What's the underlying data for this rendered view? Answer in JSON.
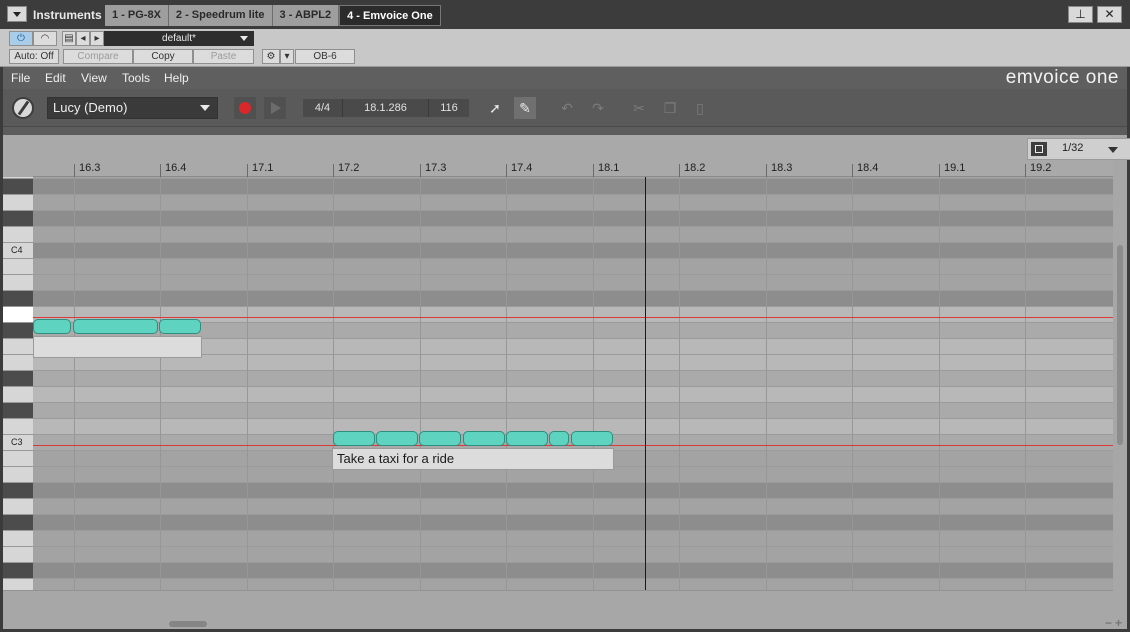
{
  "host": {
    "title": "Instruments",
    "tabs": [
      "1 - PG-8X",
      "2 - Speedrum lite",
      "3 - ABPL2",
      "4 - Emvoice One"
    ],
    "active_tab": 3,
    "pin_glyph": "⊥",
    "close_glyph": "✕"
  },
  "plugin_header": {
    "auto_label": "Auto: Off",
    "compare_label": "Compare",
    "copy_label": "Copy",
    "paste_label": "Paste",
    "preset_name": "default*",
    "device_name": "OB-6"
  },
  "menu": {
    "items": [
      "File",
      "Edit",
      "View",
      "Tools",
      "Help"
    ],
    "brand": "emvoice one"
  },
  "toolbar": {
    "voice": "Lucy (Demo)",
    "time_signature": "4/4",
    "position": "18.1.286",
    "tempo": "116",
    "icons": {
      "select": "arrow-icon",
      "draw": "pencil-icon",
      "undo": "undo-icon",
      "redo": "redo-icon",
      "cut": "scissors-icon",
      "copy": "copy-icon",
      "paste": "clipboard-icon"
    }
  },
  "ruler": {
    "bars": [
      "16.3",
      "16.4",
      "17.1",
      "17.2",
      "17.3",
      "17.4",
      "18.1",
      "18.2",
      "18.3",
      "18.4",
      "19.1",
      "19.2"
    ],
    "grid": "1/32"
  },
  "piano": {
    "labels": {
      "C4": "C4",
      "C3": "C3"
    }
  },
  "lyrics": {
    "first": "",
    "second": "Take a taxi for a ride"
  },
  "colors": {
    "note": "#5ed4c0",
    "range_line": "#d83a3a",
    "record": "#d8282a"
  }
}
